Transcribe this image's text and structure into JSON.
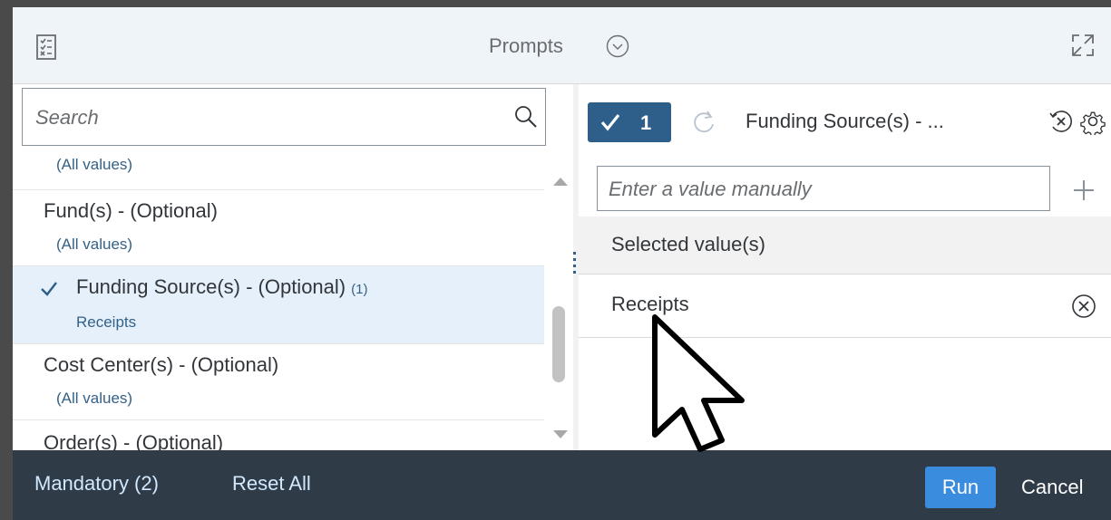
{
  "header": {
    "title": "Prompts"
  },
  "search": {
    "placeholder": "Search"
  },
  "prompt_list": [
    {
      "label": "",
      "value": "(All values)"
    },
    {
      "label": "Fund(s) - (Optional)",
      "value": "(All values)"
    },
    {
      "label": "Funding Source(s) - (Optional)",
      "count": "(1)",
      "value": "Receipts",
      "selected": true
    },
    {
      "label": "Cost Center(s) - (Optional)",
      "value": "(All values)"
    },
    {
      "label": "Order(s) - (Optional)",
      "value": ""
    }
  ],
  "detail": {
    "badge_count": "1",
    "prompt_name": "Funding Source(s) - ...",
    "manual_placeholder": "Enter a value manually",
    "selected_header": "Selected value(s)",
    "selected_values": [
      "Receipts"
    ]
  },
  "footer": {
    "mandatory": "Mandatory (2)",
    "reset_all": "Reset All",
    "run": "Run",
    "cancel": "Cancel"
  },
  "colors": {
    "accent": "#2d5f8a",
    "run_button": "#3a8dde",
    "footer_bg": "#2f3c48",
    "link": "#346187"
  },
  "icons": {
    "prompts": "prompts-icon",
    "dropdown": "chevron-down-circle-icon",
    "expand": "expand-icon",
    "search": "search-icon",
    "refresh": "refresh-icon",
    "clear": "clear-selection-icon",
    "settings": "gear-icon",
    "add": "add-icon",
    "remove": "remove-circle-icon"
  }
}
